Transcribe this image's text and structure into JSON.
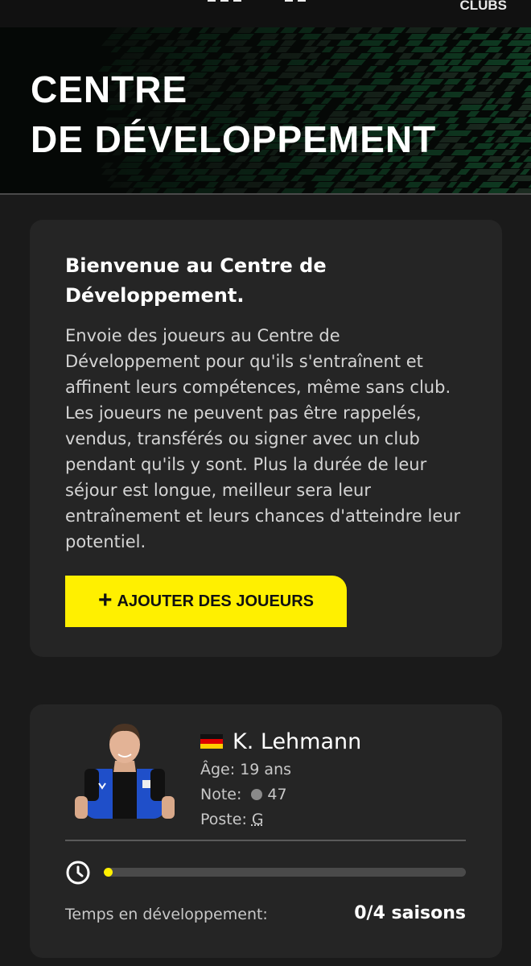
{
  "header": {
    "clubs_label": "CLUBS"
  },
  "hero": {
    "title_line1": "CENTRE",
    "title_line2": "DE DÉVELOPPEMENT",
    "accent_color": "#0f3b22"
  },
  "welcome": {
    "title": "Bienvenue au Centre de Développement.",
    "body": "Envoie des joueurs au Centre de Développement pour qu'ils s'entraînent et affinent leurs compétences, même sans club. Les joueurs ne peuvent pas être rappelés, vendus, transférés ou signer avec un club pendant qu'ils y sont. Plus la durée de leur séjour est longue, meilleur sera leur entraînement et leurs chances d'atteindre leur potentiel.",
    "add_button_icon": "plus-icon",
    "add_button_label": "AJOUTER DES JOUEURS",
    "button_color": "#fff000"
  },
  "player": {
    "flag_icon": "germany-flag-icon",
    "name": "K. Lehmann",
    "age_label": "Âge:",
    "age_value": "19 ans",
    "rating_label": "Note:",
    "rating_value": "47",
    "position_label": "Poste:",
    "position_value": "G",
    "clock_icon": "clock-icon",
    "progress_fraction": 0.02,
    "dev_label": "Temps en développement:",
    "dev_value": "0/4 saisons"
  }
}
